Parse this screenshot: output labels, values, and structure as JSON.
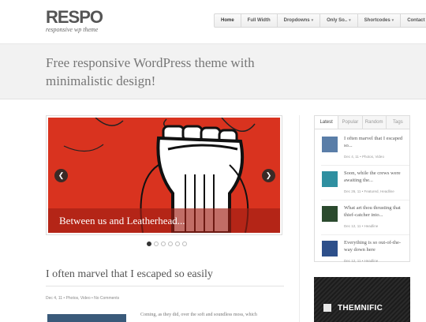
{
  "site": {
    "logo_title": "RESPO",
    "logo_subtitle": "responsive wp theme"
  },
  "nav": {
    "items": [
      {
        "label": "Home",
        "active": true,
        "dropdown": false
      },
      {
        "label": "Full Width",
        "active": false,
        "dropdown": false
      },
      {
        "label": "Dropdowns",
        "active": false,
        "dropdown": true
      },
      {
        "label": "Only So..",
        "active": false,
        "dropdown": true
      },
      {
        "label": "Shortcodes",
        "active": false,
        "dropdown": true
      },
      {
        "label": "Contact",
        "active": false,
        "dropdown": false
      }
    ],
    "caret": "▾"
  },
  "tagline": "Free responsive WordPress theme with minimalistic design!",
  "slider": {
    "caption": "Between us and Leatherhead...",
    "prev_icon": "chevron-left-icon",
    "next_icon": "chevron-right-icon",
    "prev_glyph": "❮",
    "next_glyph": "❯",
    "slide_count": 6,
    "current_slide": 1,
    "colors": {
      "background": "#d9331f",
      "caption": "#a01e14"
    }
  },
  "post": {
    "title": "I often marvel that I escaped so easily",
    "meta": "Dec 4, 11 • Photos, Video • No Comments",
    "excerpt": "Coming, as they did, over the soft and soundless moss, which"
  },
  "widget": {
    "tabs": [
      "Latest",
      "Popular",
      "Random",
      "Tags"
    ],
    "active_tab": "Latest",
    "items": [
      {
        "title": "I often marvel that I escaped so...",
        "meta": "Dec 4, 11 • Photos, Video",
        "thumb_color": "#5a7ea8"
      },
      {
        "title": "Soon, while the crews were awaiting the...",
        "meta": "Dec 26, 11 • Featured, Headline",
        "thumb_color": "#2f8fa0"
      },
      {
        "title": "What art thou thrusting that thief-catcher into...",
        "meta": "Dec 12, 11 • Headline",
        "thumb_color": "#2b4a2e"
      },
      {
        "title": "Everything is so out-of-the-way down here",
        "meta": "Dec 12, 11 • Headline",
        "thumb_color": "#2d4f8a"
      }
    ]
  },
  "ad": {
    "text": "THEMNIFIC"
  }
}
